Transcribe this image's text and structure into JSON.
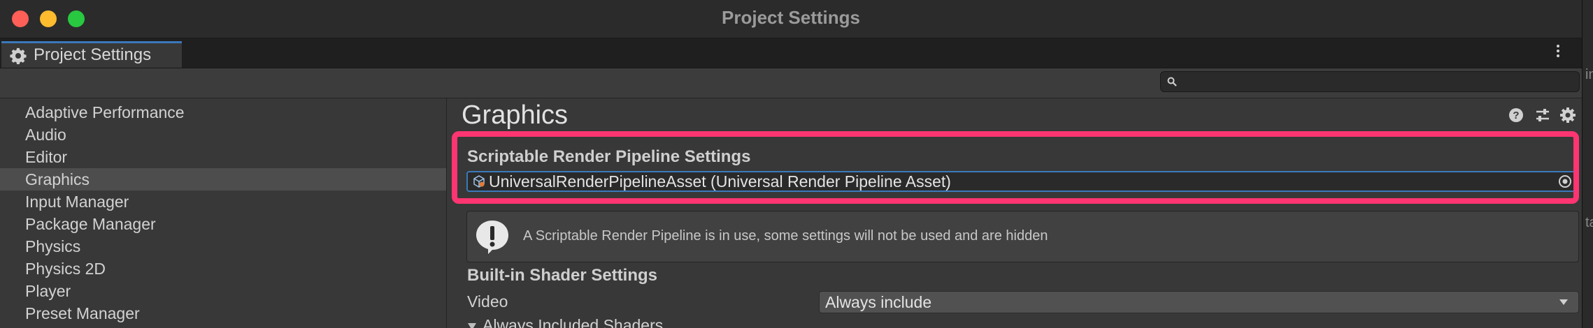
{
  "window": {
    "title": "Project Settings"
  },
  "tab": {
    "label": "Project Settings"
  },
  "search": {
    "value": ""
  },
  "sidebar": {
    "items": [
      {
        "label": "Adaptive Performance",
        "selected": false
      },
      {
        "label": "Audio",
        "selected": false
      },
      {
        "label": "Editor",
        "selected": false
      },
      {
        "label": "Graphics",
        "selected": true
      },
      {
        "label": "Input Manager",
        "selected": false
      },
      {
        "label": "Package Manager",
        "selected": false
      },
      {
        "label": "Physics",
        "selected": false
      },
      {
        "label": "Physics 2D",
        "selected": false
      },
      {
        "label": "Player",
        "selected": false
      },
      {
        "label": "Preset Manager",
        "selected": false
      }
    ]
  },
  "main": {
    "title": "Graphics",
    "srp_section": "Scriptable Render Pipeline Settings",
    "srp_asset": "UniversalRenderPipelineAsset (Universal Render Pipeline Asset)",
    "help_message": "A Scriptable Render Pipeline is in use, some settings will not be used and are hidden",
    "builtin_section": "Built-in Shader Settings",
    "video_label": "Video",
    "video_value": "Always include",
    "always_included_label": "Always Included Shaders"
  },
  "edge": {
    "text_top": "in",
    "text_bottom": "ta"
  },
  "colors": {
    "highlight": "#ff3572",
    "accent": "#3a79bb",
    "selected_row": "#4d4d4d"
  },
  "icons": {
    "tab": "gear-icon",
    "menu": "kebab-menu-icon",
    "search": "search-icon",
    "help": "help-icon",
    "presets": "sliders-icon",
    "settings": "gear-icon",
    "asset": "render-pipeline-asset-icon",
    "picker": "object-picker-icon",
    "info": "exclamation-icon",
    "dropdown": "chevron-down-icon"
  }
}
